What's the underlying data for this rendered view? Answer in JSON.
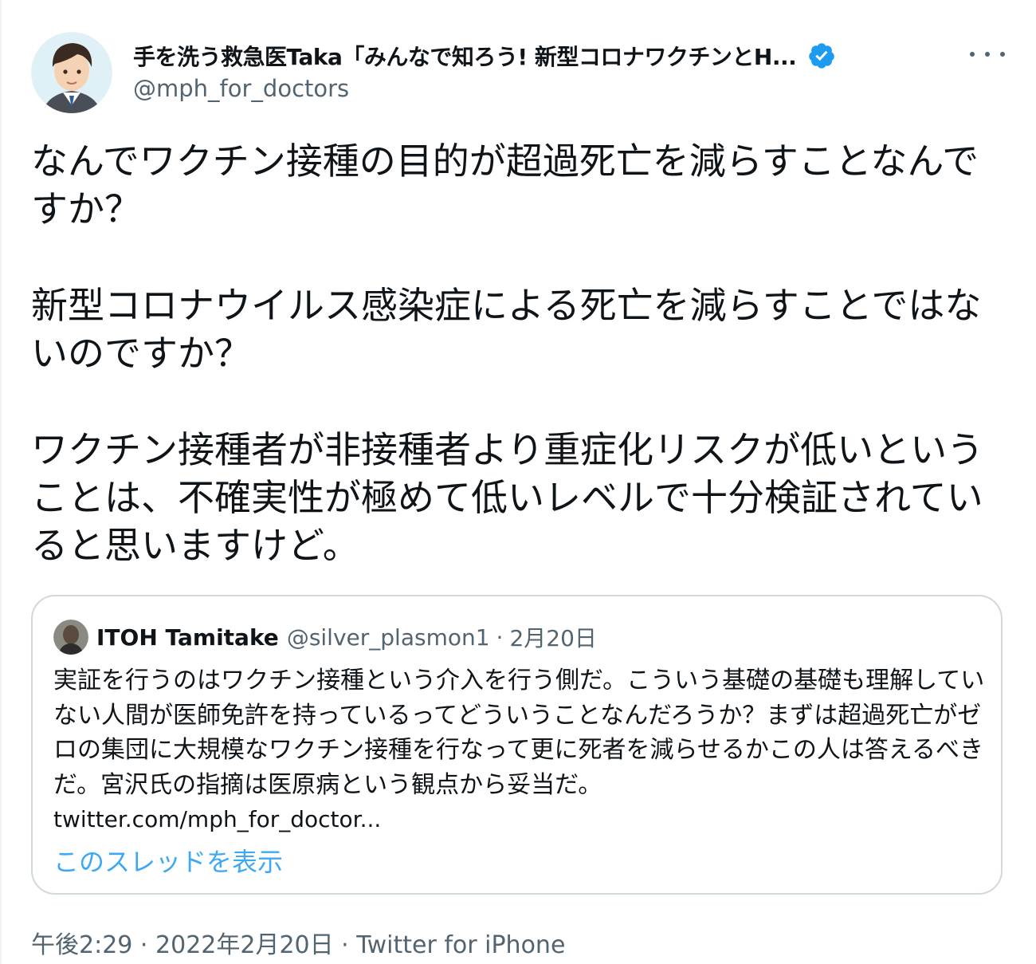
{
  "author": {
    "display_name": "手を洗う救急医Taka「みんなで知ろう! 新型コロナワクチンとH...",
    "handle": "@mph_for_doctors",
    "avatar_icon": "cartoon-avatar-icon",
    "verified_icon": "verified-badge-icon"
  },
  "tweet": {
    "paragraphs": [
      "なんでワクチン接種の目的が超過死亡を減らすことなんですか？",
      "新型コロナウイルス感染症による死亡を減らすことではないのですか？",
      "ワクチン接種者が非接種者より重症化リスクが低いということは、不確実性が極めて低いレベルで十分検証されていると思いますけど。"
    ]
  },
  "quote": {
    "name": "ITOH Tamitake",
    "handle": "@silver_plasmon1",
    "separator": "·",
    "date": "2月20日",
    "body": "実証を行うのはワクチン接種という介入を行う側だ。こういう基礎の基礎も理解していない人間が医師免許を持っているってどういうことなんだろうか？まずは超過死亡がゼロの集団に大規模なワクチン接種を行なって更に死者を減らせるかこの人は答えるべきだ。宮沢氏の指摘は医原病という観点から妥当だ。",
    "link": "twitter.com/mph_for_doctor...",
    "show_thread": "このスレッドを表示"
  },
  "meta": {
    "time": "午後2:29",
    "separator": "·",
    "date": "2022年2月20日",
    "source": "Twitter for iPhone"
  },
  "colors": {
    "text": "#0f1419",
    "secondary": "#536471",
    "accent": "#1d9bf0",
    "border": "#cfd9de"
  }
}
